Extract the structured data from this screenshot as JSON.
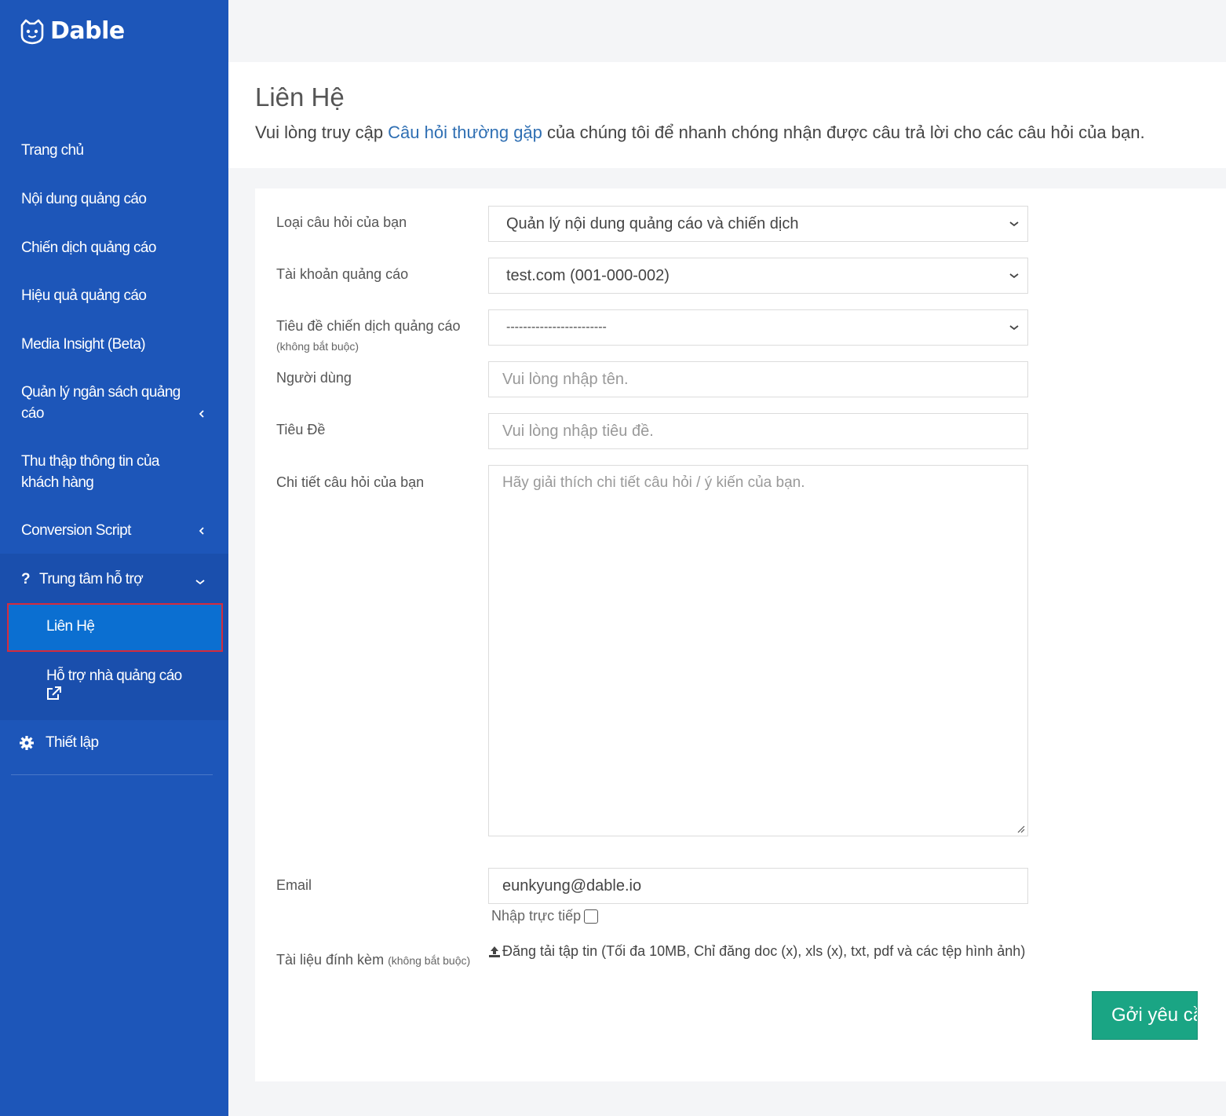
{
  "brand": {
    "name": "Dable"
  },
  "sidebar": {
    "items": [
      {
        "label": "Trang chủ"
      },
      {
        "label": "Nội dung quảng cáo"
      },
      {
        "label": "Chiến dịch quảng cáo"
      },
      {
        "label": "Hiệu quả quảng cáo"
      },
      {
        "label": "Media Insight (Beta)"
      },
      {
        "label": "Quản lý ngân sách quảng cáo"
      },
      {
        "label": "Thu thập thông tin của khách hàng"
      },
      {
        "label": "Conversion Script"
      }
    ],
    "support": {
      "label": "Trung tâm hỗ trợ",
      "icon": "question-icon",
      "children": [
        {
          "label": "Liên Hệ"
        },
        {
          "label": "Hỗ trợ nhà quảng cáo",
          "icon": "external-link-icon"
        }
      ]
    },
    "settings": {
      "label": "Thiết lập",
      "icon": "gear-icon"
    },
    "colors": {
      "background": "#1d56b9",
      "active": "#0b6fd1",
      "highlight_border": "#d62b3c"
    }
  },
  "header": {
    "title": "Liên Hệ",
    "desc_before": "Vui lòng truy cập ",
    "desc_link": "Câu hỏi thường gặp",
    "desc_after": " của chúng tôi để nhanh chóng nhận được câu trả lời cho các câu hỏi của bạn."
  },
  "form": {
    "question_type": {
      "label": "Loại câu hỏi của bạn",
      "value": "Quản lý nội dung quảng cáo và chiến dịch"
    },
    "ad_account": {
      "label": "Tài khoản quảng cáo",
      "value": "test.com (001-000-002)"
    },
    "campaign": {
      "label": "Tiêu đề chiến dịch quảng cáo",
      "optional": "(không bắt buộc)",
      "value": "------------------------"
    },
    "user": {
      "label": "Người dùng",
      "placeholder": "Vui lòng nhập tên."
    },
    "subject": {
      "label": "Tiêu Đề",
      "placeholder": "Vui lòng nhập tiêu đề."
    },
    "details": {
      "label": "Chi tiết câu hỏi của bạn",
      "placeholder": "Hãy giải thích chi tiết câu hỏi / ý kiến của bạn."
    },
    "email": {
      "label": "Email",
      "value": "eunkyung@dable.io",
      "direct_label": "Nhập trực tiếp"
    },
    "attachment": {
      "label": "Tài liệu đính kèm",
      "optional": "(không bắt buộc)",
      "upload_text": "Đăng tải tập tin (Tối đa 10MB, Chỉ đăng doc (x), xls (x), txt, pdf và các tệp hình ảnh)"
    },
    "submit_label": "Gởi yêu cầu",
    "submit_color": "#1aa584"
  }
}
